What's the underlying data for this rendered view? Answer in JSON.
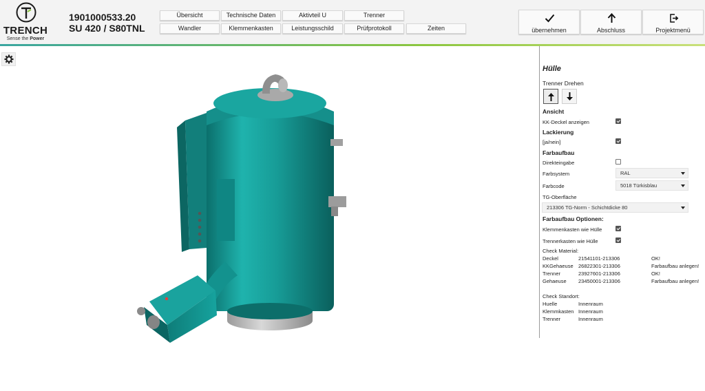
{
  "brand": {
    "name": "TRENCH",
    "tagline_prefix": "Sense the ",
    "tagline_bold": "Power",
    "accent": "#3aa6a0",
    "accent2": "#8cc63f"
  },
  "order": {
    "number": "1901000533.20",
    "model": "SU 420 / S80TNL"
  },
  "nav": {
    "row1": [
      "Übersicht",
      "Technische Daten",
      "Aktivteil U",
      "Trenner"
    ],
    "row2": [
      "Wandler",
      "Klemmenkasten",
      "Leistungsschild",
      "Prüfprotokoll",
      "Zeiten"
    ]
  },
  "actions": [
    {
      "label": "übernehmen",
      "icon": "checkmark-icon"
    },
    {
      "label": "Abschluss",
      "icon": "arrow-up-icon"
    },
    {
      "label": "Projektmenü",
      "icon": "exit-icon"
    }
  ],
  "viewer": {
    "settings_icon": "gear-icon",
    "model_color": "#1a9c98"
  },
  "panel": {
    "title": "Hülle",
    "rotate_label": "Trenner Drehen",
    "rotate_buttons": [
      "arrow-up-icon",
      "arrow-down-icon"
    ],
    "sections": {
      "ansicht": "Ansicht",
      "lackierung": "Lackierung",
      "farbaufbau": "Farbaufbau",
      "farbaufbau_optionen": "Farbaufbau Optionen:"
    },
    "kk_deckel": {
      "label": "KK-Deckel anzeigen",
      "checked": true
    },
    "ja_nein": {
      "label": "[ja/nein]",
      "checked": true
    },
    "direkteingabe": {
      "label": "Direkteingabe",
      "checked": false
    },
    "farbsystem": {
      "label": "Farbsystem",
      "value": "RAL"
    },
    "farbcode": {
      "label": "Farbcode",
      "value": "5018 Türkisblau"
    },
    "tg_oberflaeche": {
      "label": "TG-Oberfläche",
      "value": "213306 TG-Norm - Schichtdicke 80"
    },
    "klemmenkasten_wie_huelle": {
      "label": "Klemmenkasten wie Hülle",
      "checked": true
    },
    "trennerkasten_wie_huelle": {
      "label": "Trennerkasten wie Hülle",
      "checked": true
    },
    "check_material": {
      "title": "Check Material:",
      "rows": [
        {
          "name": "Deckel",
          "code": "21541101-213306",
          "status": "OK!"
        },
        {
          "name": "KKGehaeuse",
          "code": "26822301-213306",
          "status": "Farbaufbau anlegen!"
        },
        {
          "name": "Trenner",
          "code": "23927601-213306",
          "status": "OK!"
        },
        {
          "name": "Gehaeuse",
          "code": "23450001-213306",
          "status": "Farbaufbau anlegen!"
        }
      ]
    },
    "check_standort": {
      "title": "Check Standort:",
      "rows": [
        {
          "name": "Huelle",
          "value": "Innenraum"
        },
        {
          "name": "Klemmkasten",
          "value": "Innenraum"
        },
        {
          "name": "Trenner",
          "value": "Innenraum"
        }
      ]
    }
  }
}
